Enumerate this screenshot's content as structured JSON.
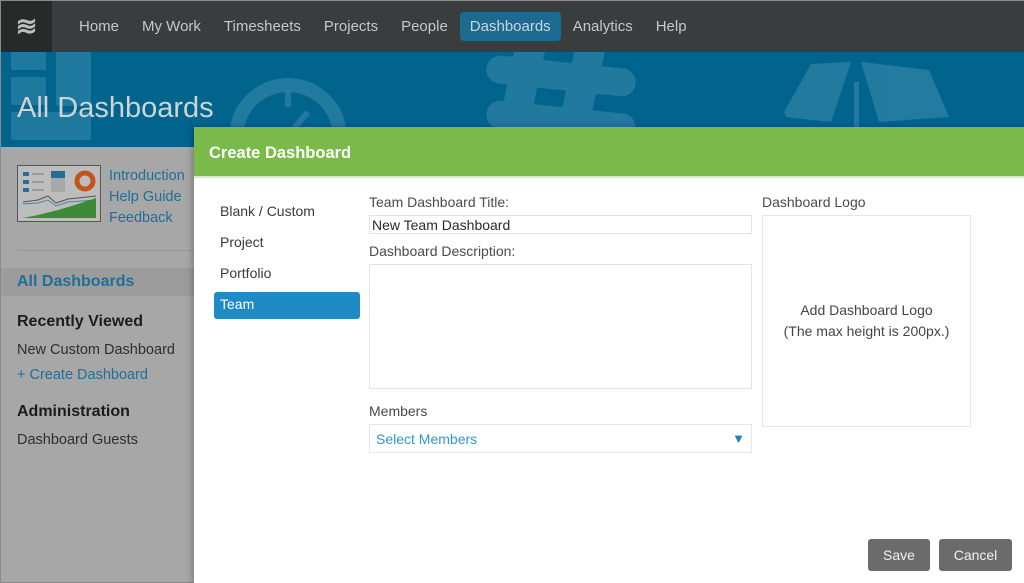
{
  "nav": {
    "logo_icon": "waves-icon",
    "items": [
      {
        "label": "Home",
        "active": false
      },
      {
        "label": "My Work",
        "active": false
      },
      {
        "label": "Timesheets",
        "active": false
      },
      {
        "label": "Projects",
        "active": false
      },
      {
        "label": "People",
        "active": false
      },
      {
        "label": "Dashboards",
        "active": true
      },
      {
        "label": "Analytics",
        "active": false
      },
      {
        "label": "Help",
        "active": false
      }
    ]
  },
  "banner": {
    "title": "All Dashboards"
  },
  "sidebar": {
    "promo_links": [
      "Introduction",
      "Help Guide",
      "Feedback"
    ],
    "active_item": "All Dashboards",
    "recently_viewed": {
      "heading": "Recently Viewed",
      "items": [
        "New Custom Dashboard"
      ],
      "create_link": "+ Create Dashboard"
    },
    "administration": {
      "heading": "Administration",
      "items": [
        "Dashboard Guests"
      ]
    }
  },
  "modal": {
    "title": "Create Dashboard",
    "types": [
      {
        "label": "Blank / Custom",
        "active": false
      },
      {
        "label": "Project",
        "active": false
      },
      {
        "label": "Portfolio",
        "active": false
      },
      {
        "label": "Team",
        "active": true
      }
    ],
    "title_label": "Team Dashboard Title:",
    "title_value": "New Team Dashboard",
    "description_label": "Dashboard Description:",
    "description_value": "",
    "members_label": "Members",
    "members_placeholder": "Select Members",
    "logo_label": "Dashboard Logo",
    "logo_line1": "Add Dashboard Logo",
    "logo_line2": "(The max height is 200px.)",
    "save_label": "Save",
    "cancel_label": "Cancel"
  },
  "colors": {
    "nav_bg": "#393d3e",
    "nav_active": "#1d6a91",
    "banner": "#00648d",
    "modal_header": "#7aba4b",
    "selected_type": "#1f8bc6",
    "link": "#2b9ad3",
    "button": "#6b6b6b"
  }
}
